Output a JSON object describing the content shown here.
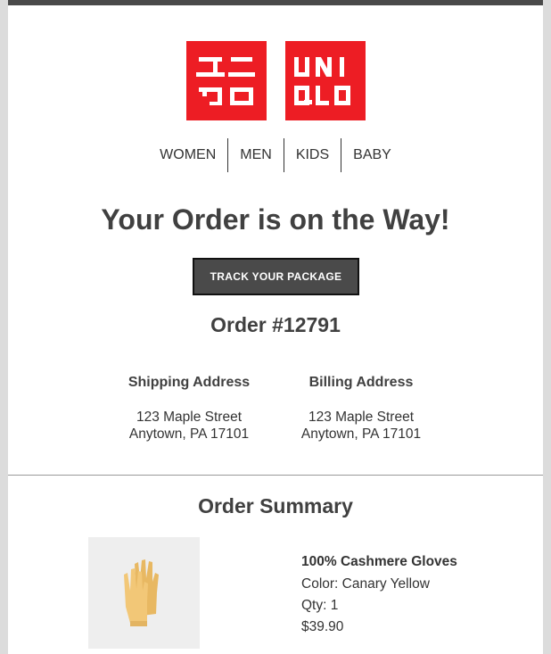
{
  "brand": {
    "logo_left_text": "ユニクロ",
    "logo_right_text": "UNIQLO",
    "logo_color": "#ed1d24"
  },
  "nav": {
    "items": [
      {
        "label": "WOMEN"
      },
      {
        "label": "MEN"
      },
      {
        "label": "KIDS"
      },
      {
        "label": "BABY"
      }
    ]
  },
  "headline": "Your Order is on the Way!",
  "track_button_label": "TRACK YOUR PACKAGE",
  "order_number": "Order #12791",
  "shipping": {
    "title": "Shipping Address",
    "line1": "123 Maple Street",
    "line2": "Anytown, PA 17101"
  },
  "billing": {
    "title": "Billing Address",
    "line1": "123 Maple Street",
    "line2": "Anytown, PA 17101"
  },
  "summary": {
    "title": "Order Summary",
    "product": {
      "name": "100% Cashmere Gloves",
      "color": "Color: Canary Yellow",
      "qty": "Qty: 1",
      "price": "$39.90",
      "image_icon": "gloves-icon",
      "image_color": "#f2c777"
    }
  }
}
